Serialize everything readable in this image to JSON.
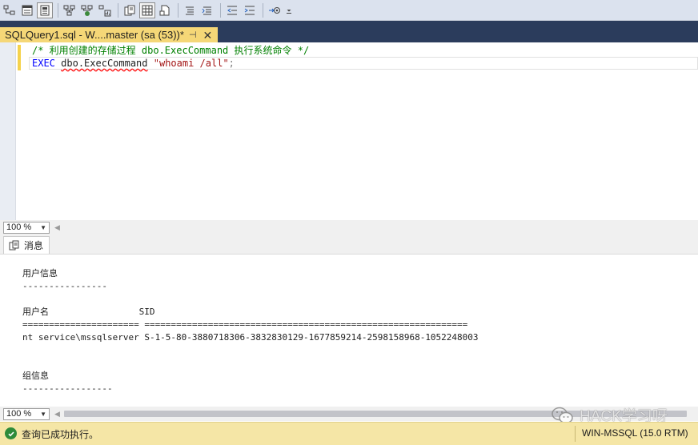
{
  "toolbar": {
    "buttons": [
      {
        "icon": "query-options-icon"
      },
      {
        "icon": "results-to-text-icon"
      },
      {
        "icon": "results-to-grid-icon",
        "pressed": true
      },
      {
        "icon": "display-plan-icon"
      },
      {
        "icon": "include-plan-icon"
      },
      {
        "icon": "client-stats-icon"
      },
      {
        "icon": "results-text-icon"
      },
      {
        "icon": "results-grid-icon"
      },
      {
        "icon": "results-file-icon"
      },
      {
        "icon": "comment-icon"
      },
      {
        "icon": "uncomment-icon"
      },
      {
        "icon": "decrease-indent-icon"
      },
      {
        "icon": "increase-indent-icon"
      },
      {
        "icon": "specify-values-icon"
      },
      {
        "icon": "overflow-icon"
      }
    ]
  },
  "tab": {
    "title": "SQLQuery1.sql - W....master (sa (53))*",
    "pin": "⊣",
    "close": "✕"
  },
  "editor": {
    "line1": "/* 利用创建的存储过程 dbo.ExecCommand 执行系统命令 */",
    "line2": {
      "keyword": "EXEC",
      "object": "dbo.ExecCommand",
      "string": "\"whoami /all\"",
      "punct": ";"
    }
  },
  "zoom": {
    "editor_value": "100 %",
    "results_value": "100 %"
  },
  "results": {
    "tab_label": "消息",
    "lines": [
      "用户信息",
      "----------------",
      "",
      "用户名                 SID",
      "====================== =============================================================",
      "nt service\\mssqlserver S-1-5-80-3880718306-3832830129-1677859214-2598158968-1052248003",
      "",
      "",
      "组信息",
      "-----------------"
    ]
  },
  "status": {
    "message": "查询已成功执行。",
    "server": "WIN-MSSQL (15.0 RTM)"
  },
  "watermark": {
    "text": "HACK学习呀"
  },
  "colors": {
    "accent_tab": "#f5d777",
    "tabstrip": "#2b3c5c",
    "status_bg": "#f5e6a6",
    "success": "#2e8b3a"
  }
}
